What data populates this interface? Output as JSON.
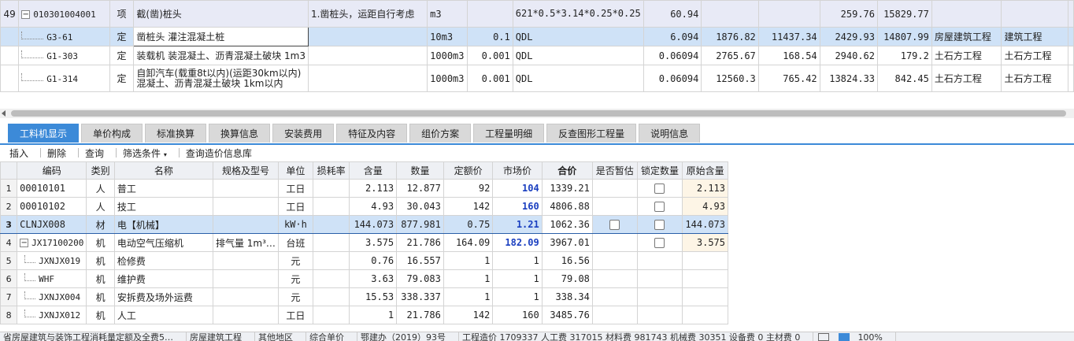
{
  "top_rows": [
    {
      "rownum": "49",
      "code": "010301004001",
      "type": "项",
      "name": "截(凿)桩头",
      "feature": "1.凿桩头，运距自行考虑",
      "unit": "m3",
      "qty_factor": "",
      "expr": "621*0.5*3.14*0.25*0.25",
      "qty": "60.94",
      "unit_price": "",
      "total": "",
      "c1": "259.76",
      "c2": "15829.77",
      "prof1": "",
      "prof2": ""
    },
    {
      "rownum": "",
      "code": "G3-61",
      "type": "定",
      "name": "凿桩头 灌注混凝土桩",
      "feature": "",
      "unit": "10m3",
      "qty_factor": "0.1",
      "expr": "QDL",
      "qty": "6.094",
      "unit_price": "1876.82",
      "total": "11437.34",
      "c1": "2429.93",
      "c2": "14807.99",
      "prof1": "房屋建筑工程",
      "prof2": "建筑工程"
    },
    {
      "rownum": "",
      "code": "G1-303",
      "type": "定",
      "name": "装载机 装混凝土、沥青混凝土破块 1m3",
      "feature": "",
      "unit": "1000m3",
      "qty_factor": "0.001",
      "expr": "QDL",
      "qty": "0.06094",
      "unit_price": "2765.67",
      "total": "168.54",
      "c1": "2940.62",
      "c2": "179.2",
      "prof1": "土石方工程",
      "prof2": "土石方工程"
    },
    {
      "rownum": "",
      "code": "G1-314",
      "type": "定",
      "name": "自卸汽车(载重8t以内)(运距30km以内) 混凝土、沥青混凝土破块 1km以内",
      "feature": "",
      "unit": "1000m3",
      "qty_factor": "0.001",
      "expr": "QDL",
      "qty": "0.06094",
      "unit_price": "12560.3",
      "total": "765.42",
      "c1": "13824.33",
      "c2": "842.45",
      "prof1": "土石方工程",
      "prof2": "土石方工程"
    }
  ],
  "tabs": [
    "工料机显示",
    "单价构成",
    "标准换算",
    "换算信息",
    "安装费用",
    "特征及内容",
    "组价方案",
    "工程量明细",
    "反查图形工程量",
    "说明信息"
  ],
  "toolbar": {
    "insert": "插入",
    "delete": "删除",
    "query": "查询",
    "filter": "筛选条件",
    "price_db": "查询造价信息库"
  },
  "bottom_headers": [
    "编码",
    "类别",
    "名称",
    "规格及型号",
    "单位",
    "损耗率",
    "含量",
    "数量",
    "定额价",
    "市场价",
    "合价",
    "是否暂估",
    "锁定数量",
    "原始含量"
  ],
  "bottom_rows": [
    {
      "rn": "1",
      "code": "00010101",
      "cat": "人",
      "name": "普工",
      "spec": "",
      "unit": "工日",
      "loss": "",
      "content": "2.113",
      "qty": "12.877",
      "quota": "92",
      "market": "104",
      "total": "1339.21",
      "est": false,
      "lock": true,
      "orig": "2.113"
    },
    {
      "rn": "2",
      "code": "00010102",
      "cat": "人",
      "name": "技工",
      "spec": "",
      "unit": "工日",
      "loss": "",
      "content": "4.93",
      "qty": "30.043",
      "quota": "142",
      "market": "160",
      "total": "4806.88",
      "est": false,
      "lock": true,
      "orig": "4.93"
    },
    {
      "rn": "3",
      "code": "CLNJX008",
      "cat": "材",
      "name": "电【机械】",
      "spec": "",
      "unit": "kW·h",
      "loss": "",
      "content": "144.073",
      "qty": "877.981",
      "quota": "0.75",
      "market": "1.21",
      "total": "1062.36",
      "est": true,
      "lock": true,
      "orig": "144.073"
    },
    {
      "rn": "4",
      "code": "JX17100200",
      "cat": "机",
      "name": "电动空气压缩机",
      "spec": "排气量 1m³…",
      "unit": "台班",
      "loss": "",
      "content": "3.575",
      "qty": "21.786",
      "quota": "164.09",
      "market": "182.09",
      "total": "3967.01",
      "est": false,
      "lock": true,
      "orig": "3.575"
    },
    {
      "rn": "5",
      "code": "JXNJX019",
      "cat": "机",
      "name": "检修费",
      "spec": "",
      "unit": "元",
      "loss": "",
      "content": "0.76",
      "qty": "16.557",
      "quota": "1",
      "market": "1",
      "total": "16.56",
      "est": false,
      "lock": false,
      "orig": ""
    },
    {
      "rn": "6",
      "code": "WHF",
      "cat": "机",
      "name": "维护费",
      "spec": "",
      "unit": "元",
      "loss": "",
      "content": "3.63",
      "qty": "79.083",
      "quota": "1",
      "market": "1",
      "total": "79.08",
      "est": false,
      "lock": false,
      "orig": ""
    },
    {
      "rn": "7",
      "code": "JXNJX004",
      "cat": "机",
      "name": "安拆费及场外运费",
      "spec": "",
      "unit": "元",
      "loss": "",
      "content": "15.53",
      "qty": "338.337",
      "quota": "1",
      "market": "1",
      "total": "338.34",
      "est": false,
      "lock": false,
      "orig": ""
    },
    {
      "rn": "8",
      "code": "JXNJX012",
      "cat": "机",
      "name": "人工",
      "spec": "",
      "unit": "工日",
      "loss": "",
      "content": "1",
      "qty": "21.786",
      "quota": "142",
      "market": "160",
      "total": "3485.76",
      "est": false,
      "lock": false,
      "orig": ""
    }
  ],
  "status": [
    "省房屋建筑与装饰工程消耗量定额及全费5…",
    "房屋建筑工程",
    "其他地区",
    "综合单价",
    "鄂建办（2019）93号",
    "工程造价 1709337   人工费 317015   材料费 981743   机械费 30351   设备费 0   主材费 0",
    "100%"
  ]
}
